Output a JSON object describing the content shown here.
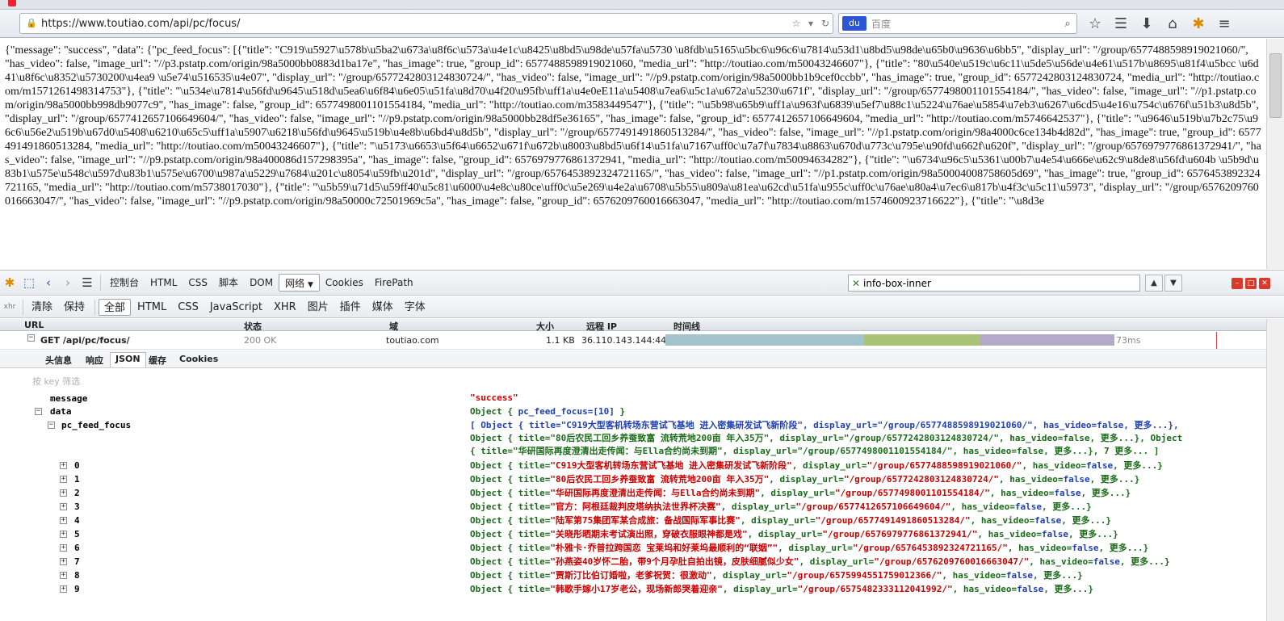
{
  "browser": {
    "url": "https://www.toutiao.com/api/pc/focus/",
    "search_engine": "百度",
    "search_placeholder": "百度"
  },
  "raw_json_text": "{\"message\": \"success\", \"data\": {\"pc_feed_focus\": [{\"title\": \"C919\\u5927\\u578b\\u5ba2\\u673a\\u8f6c\\u573a\\u4e1c\\u8425\\u8bd5\\u98de\\u57fa\\u5730 \\u8fdb\\u5165\\u5bc6\\u96c6\\u7814\\u53d1\\u8bd5\\u98de\\u65b0\\u9636\\u6bb5\", \"display_url\": \"/group/6577488598919021060/\", \"has_video\": false, \"image_url\": \"//p3.pstatp.com/origin/98a5000bb0883d1ba17e\", \"has_image\": true, \"group_id\": 6577488598919021060, \"media_url\": \"http://toutiao.com/m50043246607\"}, {\"title\": \"80\\u540e\\u519c\\u6c11\\u5de5\\u56de\\u4e61\\u517b\\u8695\\u81f4\\u5bcc \\u6d41\\u8f6c\\u8352\\u5730200\\u4ea9 \\u5e74\\u516535\\u4e07\", \"display_url\": \"/group/6577242803124830724/\", \"has_video\": false, \"image_url\": \"//p9.pstatp.com/origin/98a5000bb1b9cef0ccbb\", \"has_image\": true, \"group_id\": 6577242803124830724, \"media_url\": \"http://toutiao.com/m1571261498314753\"}, {\"title\": \"\\u534e\\u7814\\u56fd\\u9645\\u518d\\u5ea6\\u6f84\\u6e05\\u51fa\\u8d70\\u4f20\\u95fb\\uff1a\\u4e0eE11a\\u5408\\u7ea6\\u5c1a\\u672a\\u5230\\u671f\", \"display_url\": \"/group/6577498001101554184/\", \"has_video\": false, \"image_url\": \"//p1.pstatp.com/origin/98a5000bb998db9077c9\", \"has_image\": false, \"group_id\": 6577498001101554184, \"media_url\": \"http://toutiao.com/m3583449547\"}, {\"title\": \"\\u5b98\\u65b9\\uff1a\\u963f\\u6839\\u5ef7\\u88c1\\u5224\\u76ae\\u5854\\u7eb3\\u6267\\u6cd5\\u4e16\\u754c\\u676f\\u51b3\\u8d5b\", \"display_url\": \"/group/6577412657106649604/\", \"has_video\": false, \"image_url\": \"//p9.pstatp.com/origin/98a5000bb28df5e36165\", \"has_image\": false, \"group_id\": 6577412657106649604, \"media_url\": \"http://toutiao.com/m5746642537\"}, {\"title\": \"\\u9646\\u519b\\u7b2c75\\u96c6\\u56e2\\u519b\\u67d0\\u5408\\u6210\\u65c5\\uff1a\\u5907\\u6218\\u56fd\\u9645\\u519b\\u4e8b\\u6bd4\\u8d5b\", \"display_url\": \"/group/6577491491860513284/\", \"has_video\": false, \"image_url\": \"//p1.pstatp.com/origin/98a4000c6ce134b4d82d\", \"has_image\": true, \"group_id\": 6577491491860513284, \"media_url\": \"http://toutiao.com/m50043246607\"}, {\"title\": \"\\u5173\\u6653\\u5f64\\u6652\\u671f\\u672b\\u8003\\u8bd5\\u6f14\\u51fa\\u7167\\uff0c\\u7a7f\\u7834\\u8863\\u670d\\u773c\\u795e\\u90fd\\u662f\\u620f\", \"display_url\": \"/group/6576979776861372941/\", \"has_video\": false, \"image_url\": \"//p9.pstatp.com/origin/98a400086d157298395a\", \"has_image\": false, \"group_id\": 6576979776861372941, \"media_url\": \"http://toutiao.com/m50094634282\"}, {\"title\": \"\\u6734\\u96c5\\u5361\\u00b7\\u4e54\\u666e\\u62c9\\u8de8\\u56fd\\u604b \\u5b9d\\u83b1\\u575e\\u548c\\u597d\\u83b1\\u575e\\u6700\\u987a\\u5229\\u7684\\u201c\\u8054\\u59fb\\u201d\", \"display_url\": \"/group/6576453892324721165/\", \"has_video\": false, \"image_url\": \"//p1.pstatp.com/origin/98a50004008758605d69\", \"has_image\": true, \"group_id\": 6576453892324721165, \"media_url\": \"http://toutiao.com/m5738017030\"}, {\"title\": \"\\u5b59\\u71d5\\u59ff40\\u5c81\\u6000\\u4e8c\\u80ce\\uff0c\\u5e269\\u4e2a\\u6708\\u5b55\\u809a\\u81ea\\u62cd\\u51fa\\u955c\\uff0c\\u76ae\\u80a4\\u7ec6\\u817b\\u4f3c\\u5c11\\u5973\", \"display_url\": \"/group/6576209760016663047/\", \"has_video\": false, \"image_url\": \"//p9.pstatp.com/origin/98a50000c72501969c5a\", \"has_image\": false, \"group_id\": 6576209760016663047, \"media_url\": \"http://toutiao.com/m1574600923716622\"}, {\"title\": \"\\u8d3e",
  "firebug": {
    "tabs": [
      "控制台",
      "HTML",
      "CSS",
      "脚本",
      "DOM",
      "网络",
      "Cookies",
      "FirePath"
    ],
    "selected_tab": "网络",
    "search_value": "info-box-inner",
    "net_filters": [
      "清除",
      "保持",
      "全部",
      "HTML",
      "CSS",
      "JavaScript",
      "XHR",
      "图片",
      "插件",
      "媒体",
      "字体"
    ],
    "selected_filter": "全部",
    "columns": {
      "url": "URL",
      "status": "状态",
      "domain": "域",
      "size": "大小",
      "remote_ip": "远程 IP",
      "timeline": "时间线"
    },
    "request": {
      "label": "GET /api/pc/focus/",
      "status": "200 OK",
      "domain": "toutiao.com",
      "size": "1.1 KB",
      "remote_ip": "36.110.143.144:443",
      "time": "73ms"
    },
    "sub_tabs": [
      "头信息",
      "响应",
      "JSON",
      "缓存",
      "Cookies"
    ],
    "selected_sub_tab": "JSON",
    "filter_placeholder": "按 key 筛选",
    "timeline_colors": [
      "#a2c3cc",
      "#a9c474",
      "#b5a9c9"
    ]
  },
  "json_tree": {
    "message_key": "message",
    "message_value": "\"success\"",
    "data_key": "data",
    "data_summary_prefix": "Object { ",
    "data_summary_body": "pc_feed_focus=[10]",
    "data_summary_suffix": " }",
    "feed_key": "pc_feed_focus",
    "feed_summary_line1": "[ Object {  title=\"C919大型客机转场东营试飞基地 进入密集研发试飞新阶段\",  display_url=\"/group/6577488598919021060/\",  has_video=false,  更多...},",
    "feed_summary_line2": "Object {  title=\"80后农民工回乡养蚕致富 流转荒地200亩 年入35万\",  display_url=\"/group/6577242803124830724/\",  has_video=false,  更多...}, Object",
    "feed_summary_line3": "{  title=\"华研国际再度澄清出走传闻：与Ella合约尚未到期\",  display_url=\"/group/6577498001101554184/\",  has_video=false,  更多...}, 7 更多... ]",
    "items": [
      {
        "index": "0",
        "title": "C919大型客机转场东营试飞基地 进入密集研发试飞新阶段",
        "display_url": "/group/6577488598919021060/"
      },
      {
        "index": "1",
        "title": "80后农民工回乡养蚕致富 流转荒地200亩 年入35万",
        "display_url": "/group/6577242803124830724/"
      },
      {
        "index": "2",
        "title": "华研国际再度澄清出走传闻：与Ella合约尚未到期",
        "display_url": "/group/6577498001101554184/"
      },
      {
        "index": "3",
        "title": "官方：阿根廷裁判皮塔纳执法世界杯决赛",
        "display_url": "/group/6577412657106649604/"
      },
      {
        "index": "4",
        "title": "陆军第75集团军某合成旅：备战国际军事比赛",
        "display_url": "/group/6577491491860513284/"
      },
      {
        "index": "5",
        "title": "关晓彤晒期末考试演出照，穿破衣服眼神都是戏",
        "display_url": "/group/6576979776861372941/"
      },
      {
        "index": "6",
        "title": "朴雅卡·乔普拉跨国恋 宝莱坞和好莱坞最顺利的“联姻”",
        "display_url": "/group/6576453892324721165/"
      },
      {
        "index": "7",
        "title": "孙燕姿40岁怀二胎，带9个月孕肚自拍出镜，皮肤细腻似少女",
        "display_url": "/group/6576209760016663047/"
      },
      {
        "index": "8",
        "title": "贾斯汀比伯订婚啦，老爹祝贺：很激动",
        "display_url": "/group/6575994551759012366/"
      },
      {
        "index": "9",
        "title": "韩歌手嫁小17岁老公，现场新郎哭着迎亲",
        "display_url": "/group/6575482333112041992/"
      }
    ],
    "object_prefix": "Object {  title=",
    "display_url_label": "display_url=",
    "has_video_label": "has_video=",
    "has_video_value": "false",
    "more_label": "更多...",
    "object_suffix": "}"
  }
}
